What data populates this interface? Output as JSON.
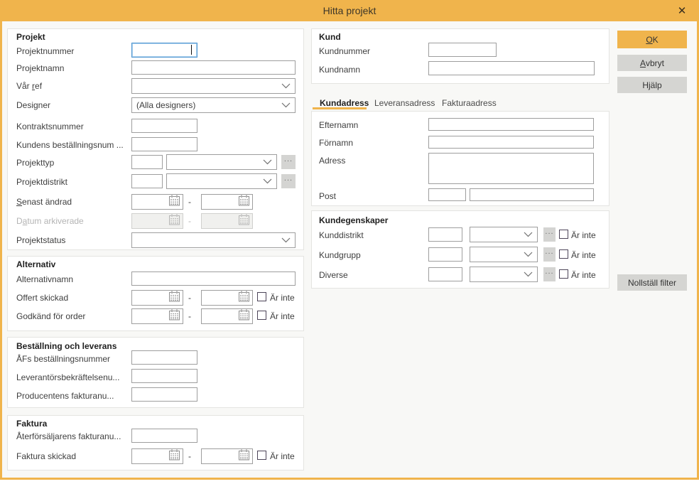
{
  "window": {
    "title": "Hitta projekt"
  },
  "colors": {
    "accent": "#F0B44C",
    "focus_border": "#4F96D1"
  },
  "misc": {
    "ar_inte": "Är inte",
    "range_separator": "-",
    "ellipsis": "...",
    "close": "✕"
  },
  "actions": {
    "ok": {
      "pre": "",
      "key": "O",
      "post": "K"
    },
    "cancel": {
      "pre": "",
      "key": "A",
      "post": "vbryt"
    },
    "help": "Hjälp",
    "reset_filter": "Nollställ filter"
  },
  "projekt": {
    "header": "Projekt",
    "projektnummer": "Projektnummer",
    "projektnamn": "Projektnamn",
    "var_ref": {
      "pre": "Vår ",
      "key": "r",
      "post": "ef"
    },
    "designer": "Designer",
    "designer_value": "(Alla designers)",
    "kontraktsnummer": "Kontraktsnummer",
    "kundens_bestallningsnum": "Kundens beställningsnum ...",
    "projekttyp": "Projekttyp",
    "projektdistrikt": "Projektdistrikt",
    "senast_andrad": {
      "pre": "",
      "key": "S",
      "post": "enast ändrad"
    },
    "datum_arkiverade": {
      "pre": "D",
      "key": "a",
      "post": "tum arkiverade"
    },
    "projektstatus": "Projektstatus"
  },
  "alternativ": {
    "header": "Alternativ",
    "alternativnamn": "Alternativnamn",
    "offert_skickad": "Offert skickad",
    "godkand_for_order": "Godkänd för order"
  },
  "bestallning": {
    "header": "Beställning och leverans",
    "afs_bestallningsnummer": "ÅFs beställningsnummer",
    "leverantorsbekraftelsenu": "Leverantörsbekräftelsenu...",
    "producentens_fakturanu": "Producentens fakturanu..."
  },
  "faktura": {
    "header": "Faktura",
    "aterforsaljarens_fakturanu": "Återförsäljarens fakturanu...",
    "faktura_skickad": "Faktura skickad"
  },
  "kund": {
    "header": "Kund",
    "kundnummer": "Kundnummer",
    "kundnamn": "Kundnamn"
  },
  "tabs": {
    "kundadress": "Kundadress",
    "leveransadress": "Leveransadress",
    "fakturaadress": "Fakturaadress"
  },
  "adress": {
    "efternamn": "Efternamn",
    "fornamn": "Förnamn",
    "adress": "Adress",
    "post": "Post"
  },
  "kundegenskaper": {
    "header": "Kundegenskaper",
    "kunddistrikt": "Kunddistrikt",
    "kundgrupp": "Kundgrupp",
    "diverse": "Diverse"
  }
}
